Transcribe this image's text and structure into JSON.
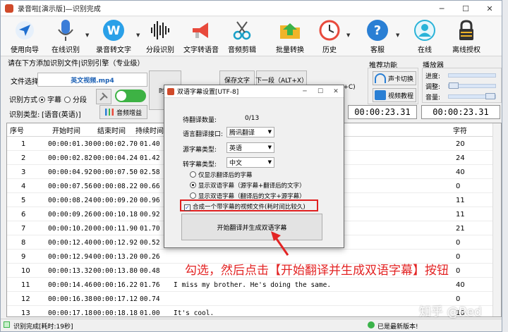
{
  "window": {
    "title": "录音啦[演示版]—识别完成"
  },
  "toolbar": {
    "items": [
      {
        "label": "使用向导",
        "icon": "navigation-arrow-icon"
      },
      {
        "label": "在线识别",
        "icon": "microphone-icon"
      },
      {
        "label": "录音转文字",
        "icon": "w-logo-icon"
      },
      {
        "label": "分段识别",
        "icon": "waveform-icon"
      },
      {
        "label": "文字转语音",
        "icon": "megaphone-icon"
      },
      {
        "label": "音频剪辑",
        "icon": "scissors-icon"
      },
      {
        "label": "批量转换",
        "icon": "folder-arrow-icon"
      },
      {
        "label": "历史",
        "icon": "history-clock-icon"
      },
      {
        "label": "客服",
        "icon": "help-icon"
      },
      {
        "label": "在线",
        "icon": "online-user-icon"
      },
      {
        "label": "离线授权",
        "icon": "lock-icon"
      }
    ]
  },
  "instruction": "请在下方添加识别文件|识别引擎（专业级）",
  "file": {
    "label": "文件选择",
    "value": "英文视频.mp4"
  },
  "recognize_mode": {
    "label": "识别方式",
    "option1": "字幕",
    "option2": "分段"
  },
  "recognize_type": {
    "label": "识别类型:",
    "value": "[语音(英语)]"
  },
  "enhance_button": "音频增益",
  "mid_buttons": {
    "time": "时间",
    "save": "保存文字",
    "next": "下一段（ALT+X）",
    "partial": "+C)"
  },
  "recommend": {
    "title": "推荐功能",
    "sound_card": "声卡切换",
    "video_tutorial": "视频教程"
  },
  "player": {
    "title": "播放器",
    "progress": "进度:",
    "adjust": "调整:",
    "volume": "音量:"
  },
  "times": {
    "t1": "00:00:23.31",
    "t2": "00:00:23.31"
  },
  "table": {
    "headers": {
      "index": "序号",
      "start": "开始时间",
      "end": "结束时间",
      "dur": "持续时间",
      "chars": "字符"
    },
    "rows": [
      {
        "i": "1",
        "s": "00:00:01.30",
        "e": "00:00:02.70",
        "d": "01.40",
        "text": "",
        "c": "20"
      },
      {
        "i": "2",
        "s": "00:00:02.82",
        "e": "00:00:04.24",
        "d": "01.42",
        "text": "",
        "c": "24"
      },
      {
        "i": "3",
        "s": "00:00:04.92",
        "e": "00:00:07.50",
        "d": "02.58",
        "text": "",
        "c": "40"
      },
      {
        "i": "4",
        "s": "00:00:07.56",
        "e": "00:00:08.22",
        "d": "00.66",
        "text": "",
        "c": "0"
      },
      {
        "i": "5",
        "s": "00:00:08.24",
        "e": "00:00:09.20",
        "d": "00.96",
        "text": "",
        "c": "11"
      },
      {
        "i": "6",
        "s": "00:00:09.26",
        "e": "00:00:10.18",
        "d": "00.92",
        "text": "",
        "c": "11"
      },
      {
        "i": "7",
        "s": "00:00:10.20",
        "e": "00:00:11.90",
        "d": "01.70",
        "text": "",
        "c": "21"
      },
      {
        "i": "8",
        "s": "00:00:12.40",
        "e": "00:00:12.92",
        "d": "00.52",
        "text": "",
        "c": "0"
      },
      {
        "i": "9",
        "s": "00:00:12.94",
        "e": "00:00:13.20",
        "d": "00.26",
        "text": "",
        "c": "0"
      },
      {
        "i": "10",
        "s": "00:00:13.32",
        "e": "00:00:13.80",
        "d": "00.48",
        "text": "",
        "c": "0"
      },
      {
        "i": "11",
        "s": "00:00:14.46",
        "e": "00:00:16.22",
        "d": "01.76",
        "text": "I miss my brother. He's doing the same.",
        "c": "40"
      },
      {
        "i": "12",
        "s": "00:00:16.38",
        "e": "00:00:17.12",
        "d": "00.74",
        "text": "",
        "c": "0"
      },
      {
        "i": "13",
        "s": "00:00:17.18",
        "e": "00:00:18.18",
        "d": "01.00",
        "text": "It's cool.",
        "c": "10"
      }
    ]
  },
  "status": {
    "left": "识别完成[耗时:19秒]",
    "right": "已是最新版本!"
  },
  "dialog": {
    "title": "双语字幕设置[UTF-8]",
    "count_label": "待翻译数量:",
    "count_value": "0/13",
    "api_label": "语言翻译接口:",
    "api_value": "腾讯翻译",
    "source_label": "源字幕类型:",
    "source_value": "英语",
    "target_label": "转字幕类型:",
    "target_value": "中文",
    "radio1": "仅显示翻译后的字幕",
    "radio2": "显示双语字幕（源字幕+翻译后的文字）",
    "radio3": "显示双语字幕（翻译后的文字+源字幕）",
    "checkbox": "合成一个带字幕的视频文件(耗时间比较久)",
    "start_button": "开始翻译并生成双语字幕"
  },
  "annotation": "勾选，然后点击【开始翻译并生成双语字幕】按钮",
  "watermark": "知乎 @Red",
  "colors": {
    "accent": "#1a5fb4",
    "toggle_on": "#3db244",
    "highlight": "#e02020"
  }
}
